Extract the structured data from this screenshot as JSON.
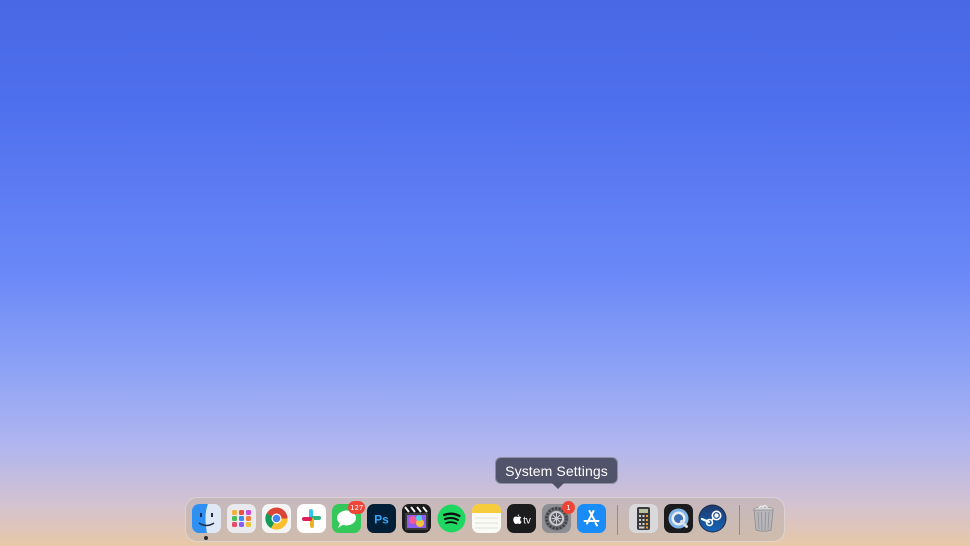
{
  "tooltip": {
    "text": "System Settings"
  },
  "dock": {
    "apps": [
      {
        "name": "Finder",
        "icon": "finder-icon",
        "running": true
      },
      {
        "name": "Launchpad",
        "icon": "launchpad-icon"
      },
      {
        "name": "Google Chrome",
        "icon": "chrome-icon"
      },
      {
        "name": "Slack",
        "icon": "slack-icon"
      },
      {
        "name": "Messages",
        "icon": "messages-icon",
        "badge": "127"
      },
      {
        "name": "Adobe Photoshop",
        "icon": "photoshop-icon",
        "label": "Ps"
      },
      {
        "name": "Final Cut Pro",
        "icon": "final-cut-pro-icon"
      },
      {
        "name": "Spotify",
        "icon": "spotify-icon"
      },
      {
        "name": "Notes",
        "icon": "notes-icon"
      },
      {
        "name": "Apple TV",
        "icon": "apple-tv-icon",
        "label": "tv"
      },
      {
        "name": "System Settings",
        "icon": "system-settings-icon",
        "badge": "1"
      },
      {
        "name": "App Store",
        "icon": "app-store-icon"
      }
    ],
    "utilities": [
      {
        "name": "Calculator",
        "icon": "calculator-icon"
      },
      {
        "name": "QuickTime Player",
        "icon": "quicktime-icon"
      },
      {
        "name": "Steam",
        "icon": "steam-icon"
      }
    ],
    "trash": {
      "name": "Trash",
      "icon": "trash-icon"
    }
  },
  "colors": {
    "badge": "#f04437",
    "wallpaper_top": "#4868e6",
    "wallpaper_bottom": "#e8c8a8"
  }
}
